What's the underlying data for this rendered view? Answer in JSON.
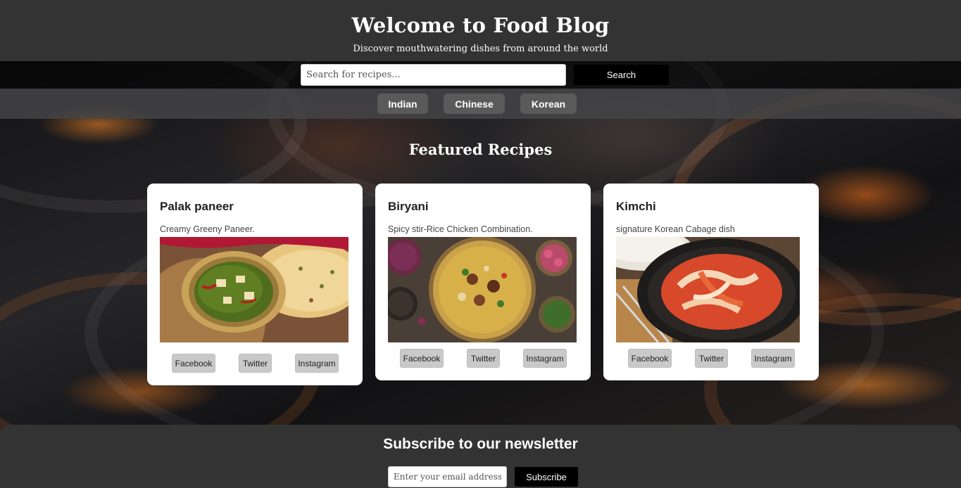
{
  "header": {
    "title": "Welcome to Food Blog",
    "subtitle": "Discover mouthwatering dishes from around the world"
  },
  "search": {
    "placeholder": "Search for recipes...",
    "button_label": "Search"
  },
  "categories": [
    "Indian",
    "Chinese",
    "Korean"
  ],
  "featured": {
    "title": "Featured Recipes",
    "recipes": [
      {
        "title": "Palak paneer",
        "description": "Creamy Greeny Paneer.",
        "image": "palak-paneer-photo"
      },
      {
        "title": "Biryani",
        "description": "Spicy stir-Rice Chicken Combination.",
        "image": "biryani-photo"
      },
      {
        "title": "Kimchi",
        "description": "signature Korean Cabage dish",
        "image": "kimchi-photo"
      }
    ],
    "share_labels": [
      "Facebook",
      "Twitter",
      "Instagram"
    ]
  },
  "newsletter": {
    "title": "Subscribe to our newsletter",
    "email_placeholder": "Enter your email address",
    "button_label": "Subscribe"
  },
  "colors": {
    "header_bg": "#333333",
    "button_dark": "#000000",
    "category_button": "#5a5a5a",
    "card_bg": "#ffffff",
    "share_button": "#c9c9c9"
  }
}
